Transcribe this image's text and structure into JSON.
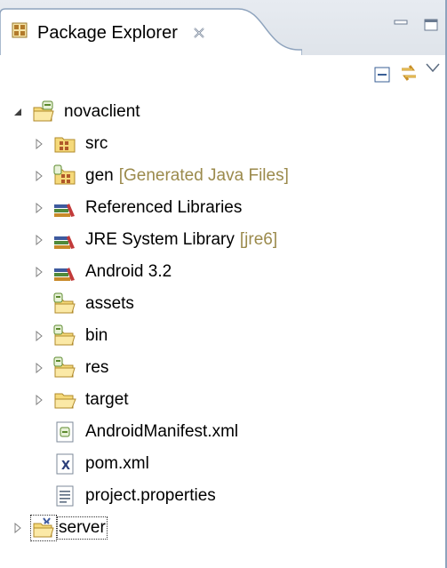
{
  "view": {
    "title": "Package Explorer",
    "close_icon": "close-x-icon",
    "minimize_icon": "minimize-icon",
    "maximize_icon": "maximize-icon"
  },
  "toolbar": {
    "collapse_all_icon": "collapse-all-icon",
    "link_with_editor_icon": "link-with-editor-icon",
    "view_menu_icon": "view-menu-chevron-icon"
  },
  "tree": {
    "project": {
      "label": "novaclient",
      "expanded": true,
      "icon": "android-project-icon"
    },
    "children": [
      {
        "label": "src",
        "decoration": "",
        "icon": "source-folder-icon",
        "expandable": true
      },
      {
        "label": "gen",
        "decoration": "[Generated Java Files]",
        "icon": "generated-source-folder-icon",
        "expandable": true
      },
      {
        "label": "Referenced Libraries",
        "decoration": "",
        "icon": "library-icon",
        "expandable": true
      },
      {
        "label": "JRE System Library",
        "decoration": "[jre6]",
        "icon": "library-icon",
        "expandable": true
      },
      {
        "label": "Android 3.2",
        "decoration": "",
        "icon": "library-icon",
        "expandable": true
      },
      {
        "label": "assets",
        "decoration": "",
        "icon": "android-folder-icon",
        "expandable": false
      },
      {
        "label": "bin",
        "decoration": "",
        "icon": "android-folder-icon",
        "expandable": true
      },
      {
        "label": "res",
        "decoration": "",
        "icon": "android-folder-icon",
        "expandable": true
      },
      {
        "label": "target",
        "decoration": "",
        "icon": "folder-icon",
        "expandable": true
      },
      {
        "label": "AndroidManifest.xml",
        "decoration": "",
        "icon": "android-manifest-file-icon",
        "expandable": false
      },
      {
        "label": "pom.xml",
        "decoration": "",
        "icon": "xml-file-icon",
        "expandable": false
      },
      {
        "label": "project.properties",
        "decoration": "",
        "icon": "properties-file-icon",
        "expandable": false
      }
    ],
    "second_project": {
      "label": "server",
      "expanded": false,
      "icon": "project-folder-icon"
    }
  },
  "colors": {
    "decoration": "#9b8a4c",
    "tab_border": "#8ea3bd",
    "tabstrip_bg": "#e3e8ee"
  }
}
